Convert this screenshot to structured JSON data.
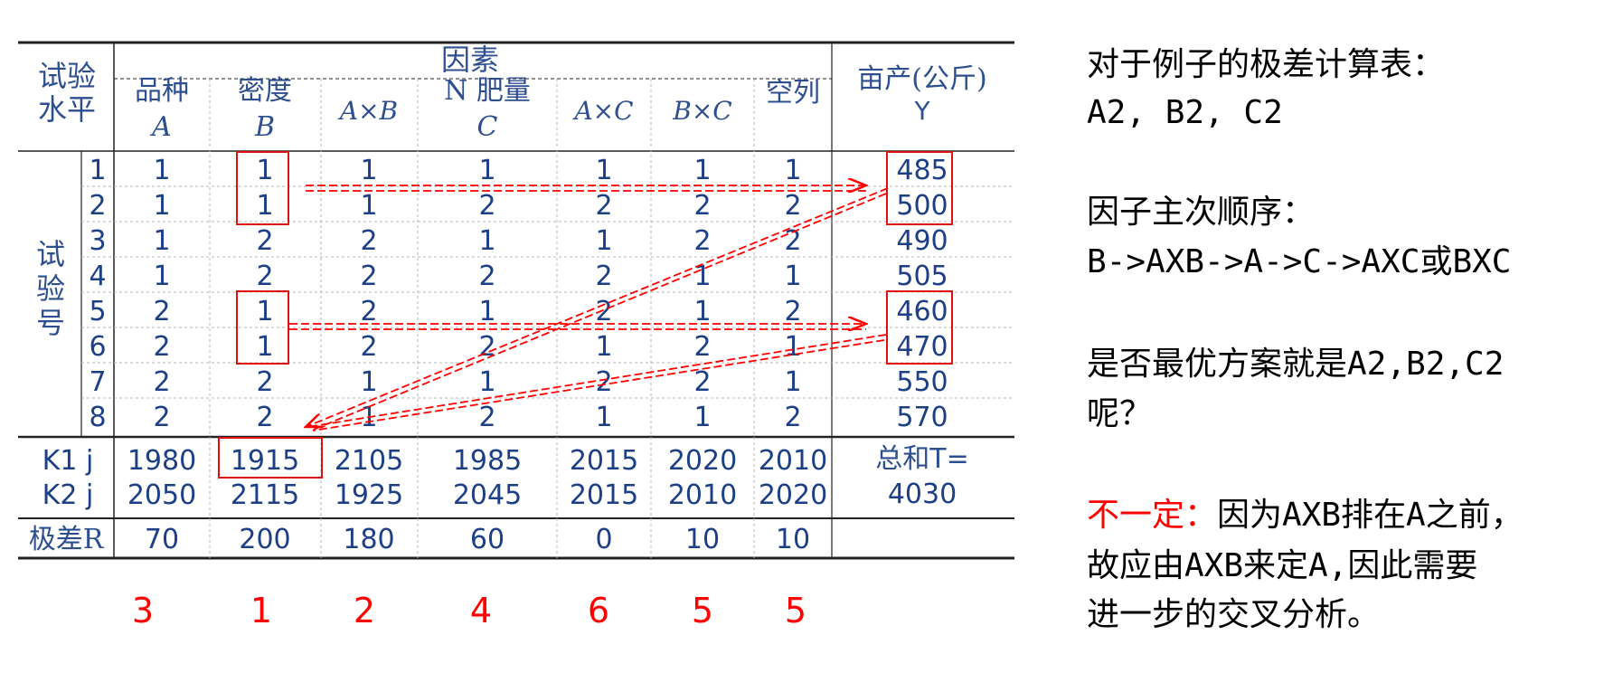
{
  "table": {
    "header_left": [
      "试验",
      "水平"
    ],
    "factor_group_label": "因素",
    "columns": [
      {
        "name": "品种",
        "letter": "A"
      },
      {
        "name": "密度",
        "letter": "B"
      },
      {
        "name": "",
        "letter": "A×B"
      },
      {
        "name": "N 肥量",
        "letter": "C"
      },
      {
        "name": "",
        "letter": "A×C"
      },
      {
        "name": "",
        "letter": "B×C"
      },
      {
        "name": "空列",
        "letter": ""
      }
    ],
    "yield_header": [
      "亩产(公斤)",
      "Y"
    ],
    "trial_group_label": "试验号",
    "rows": [
      {
        "no": "1",
        "levels": [
          "1",
          "1",
          "1",
          "1",
          "1",
          "1",
          "1"
        ],
        "y": "485"
      },
      {
        "no": "2",
        "levels": [
          "1",
          "1",
          "1",
          "2",
          "2",
          "2",
          "2"
        ],
        "y": "500"
      },
      {
        "no": "3",
        "levels": [
          "1",
          "2",
          "2",
          "1",
          "1",
          "2",
          "2"
        ],
        "y": "490"
      },
      {
        "no": "4",
        "levels": [
          "1",
          "2",
          "2",
          "2",
          "2",
          "1",
          "1"
        ],
        "y": "505"
      },
      {
        "no": "5",
        "levels": [
          "2",
          "1",
          "2",
          "1",
          "2",
          "1",
          "2"
        ],
        "y": "460"
      },
      {
        "no": "6",
        "levels": [
          "2",
          "1",
          "2",
          "2",
          "1",
          "2",
          "1"
        ],
        "y": "470"
      },
      {
        "no": "7",
        "levels": [
          "2",
          "2",
          "1",
          "1",
          "2",
          "2",
          "1"
        ],
        "y": "550"
      },
      {
        "no": "8",
        "levels": [
          "2",
          "2",
          "1",
          "2",
          "1",
          "1",
          "2"
        ],
        "y": "570"
      }
    ],
    "k1_label": "K1 j",
    "k2_label": "K2 j",
    "k1": [
      "1980",
      "1915",
      "2105",
      "1985",
      "2015",
      "2020",
      "2010"
    ],
    "k2": [
      "2050",
      "2115",
      "1925",
      "2045",
      "2015",
      "2010",
      "2020"
    ],
    "total": [
      "总和T=",
      "4030"
    ],
    "range_label": "极差R",
    "range": [
      "70",
      "200",
      "180",
      "60",
      "0",
      "10",
      "10"
    ]
  },
  "ranks": [
    "3",
    "1",
    "2",
    "4",
    "6",
    "5",
    "5"
  ],
  "side": {
    "line1": "对于例子的极差计算表：",
    "line2": "A2, B2, C2",
    "line3": "因子主次顺序：",
    "line4": "B->AXB->A->C->AXC或BXC",
    "line5": "是否最优方案就是A2,B2,C2",
    "line6": "呢？",
    "not_sure": "不一定：",
    "line7_rest": "因为AXB排在A之前，",
    "line8": "故应由AXB来定A,因此需要",
    "line9": "进一步的交叉分析。"
  },
  "colors": {
    "table_text": "#1d3f86",
    "accent": "#ff0000"
  }
}
